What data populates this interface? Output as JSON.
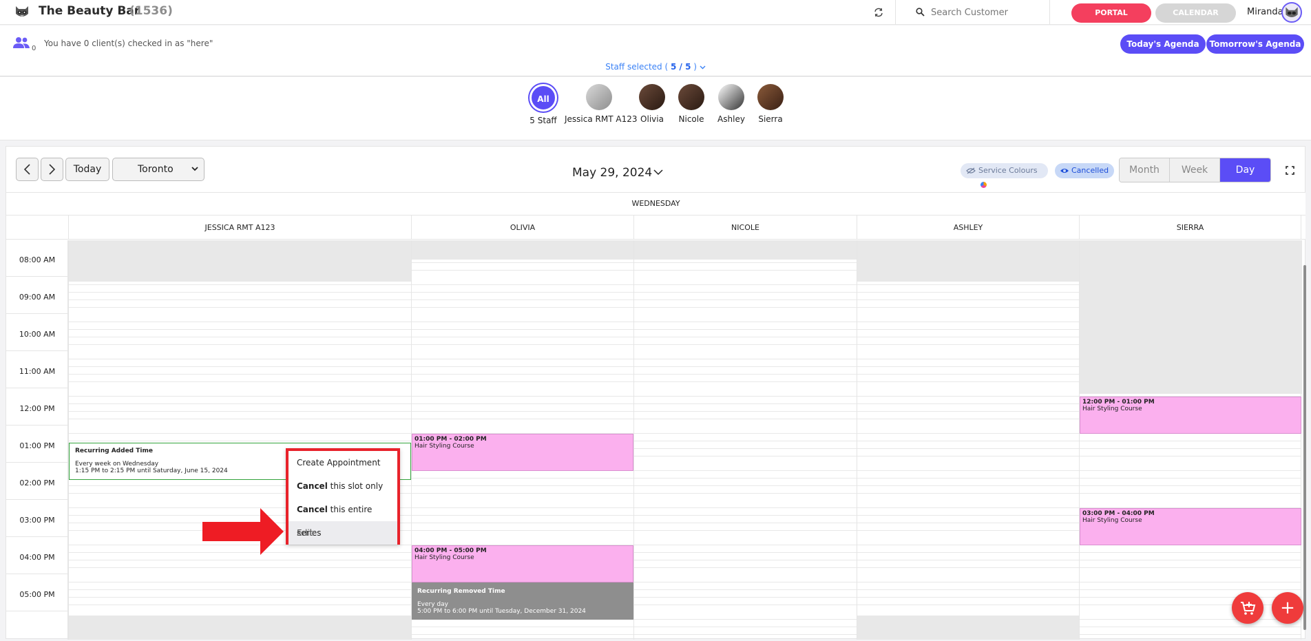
{
  "header": {
    "app_title": "The Beauty Bar",
    "app_count": "(1536)",
    "search_placeholder": "Search Customer",
    "portal_label": "PORTAL",
    "calendar_label": "CALENDAR",
    "user_name": "Miranda"
  },
  "subbar": {
    "checked_in_count": "0",
    "checkin_text": "You have 0 client(s) checked in as \"here\"",
    "todays_agenda": "Today's Agenda",
    "tomorrows_agenda": "Tomorrow's Agenda",
    "staff_selected_prefix": "Staff selected (",
    "staff_selected_value": "5 / 5",
    "staff_selected_suffix": ")"
  },
  "staff": [
    {
      "avatar": "All",
      "label": "5 Staff"
    },
    {
      "label": "Jessica RMT A123"
    },
    {
      "label": "Olivia"
    },
    {
      "label": "Nicole"
    },
    {
      "label": "Ashley"
    },
    {
      "label": "Sierra"
    }
  ],
  "toolbar": {
    "today_label": "Today",
    "timezone": "Toronto",
    "date": "May 29, 2024",
    "service_colours": "Service Colours",
    "cancelled": "Cancelled",
    "views": [
      "Month",
      "Week",
      "Day"
    ],
    "active_view": "Day"
  },
  "calendar": {
    "day_name": "WEDNESDAY",
    "columns": [
      "JESSICA RMT A123",
      "OLIVIA",
      "NICOLE",
      "ASHLEY",
      "SIERRA"
    ],
    "times": [
      "08:00 AM",
      "09:00 AM",
      "10:00 AM",
      "11:00 AM",
      "12:00 PM",
      "01:00 PM",
      "02:00 PM",
      "03:00 PM",
      "04:00 PM",
      "05:00 PM"
    ],
    "events": {
      "sierra_1": {
        "time": "12:00 PM - 01:00 PM",
        "title": "Hair Styling Course"
      },
      "olivia_1": {
        "time": "01:00 PM - 02:00 PM",
        "title": "Hair Styling Course"
      },
      "sierra_2": {
        "time": "03:00 PM - 04:00 PM",
        "title": "Hair Styling Course"
      },
      "olivia_2": {
        "time": "04:00 PM - 05:00 PM",
        "title": "Hair Styling Course"
      },
      "recurring_added": {
        "title": "Recurring Added Time",
        "line1": "Every week on Wednesday",
        "line2": "1:15 PM to 2:15 PM until Saturday, June 15, 2024"
      },
      "recurring_removed": {
        "title": "Recurring Removed Time",
        "line1": "Every day",
        "line2": "5:00 PM to 6:00 PM until Tuesday, December 31, 2024"
      }
    }
  },
  "context_menu": {
    "create": "Create Appointment",
    "cancel_word": "Cancel",
    "slot_only": " this slot only",
    "entire_series": " this entire series",
    "edit": "Edit"
  },
  "fabs": {
    "add": "+"
  }
}
